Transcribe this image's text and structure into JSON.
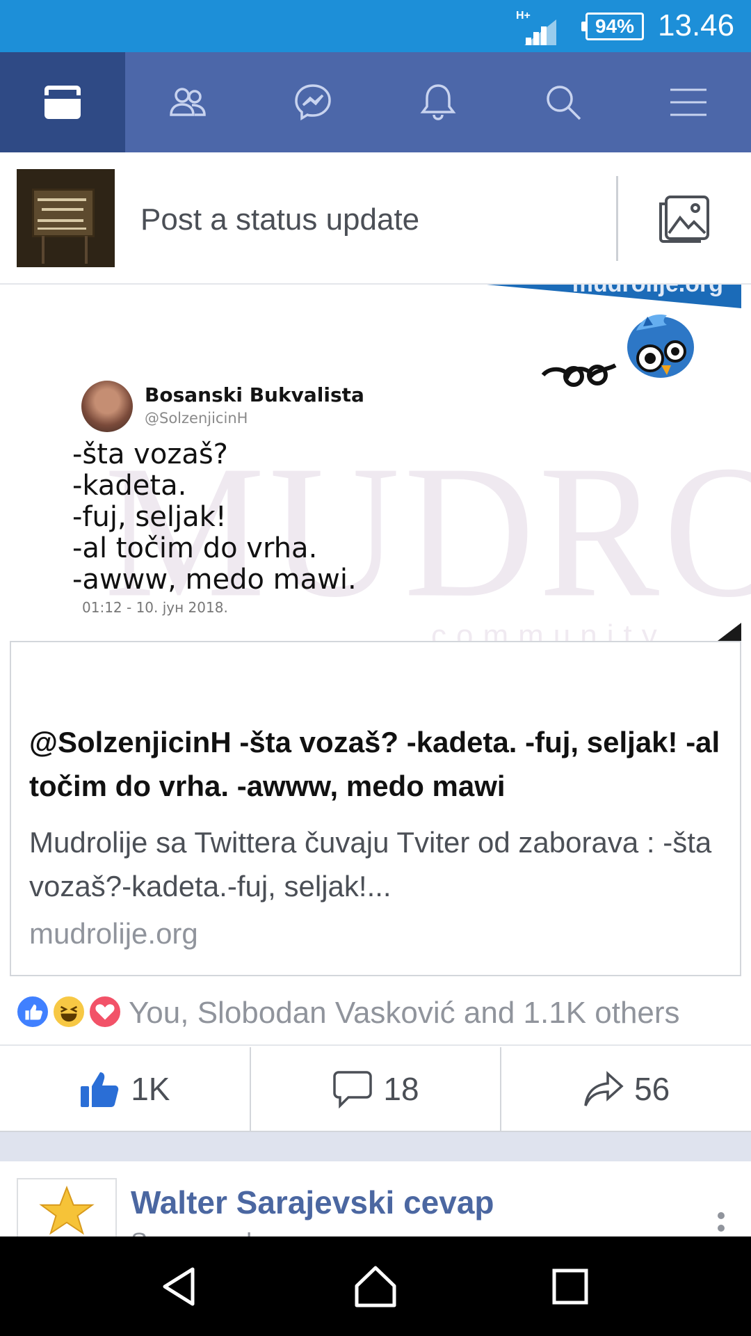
{
  "status_bar": {
    "network": "H+",
    "battery": "94%",
    "time": "13.46"
  },
  "top_nav": {
    "tabs": [
      {
        "name": "news-feed",
        "icon": "news-feed-icon",
        "active": true
      },
      {
        "name": "friends",
        "icon": "friends-icon",
        "active": false
      },
      {
        "name": "messenger",
        "icon": "messenger-icon",
        "active": false
      },
      {
        "name": "notifications",
        "icon": "bell-icon",
        "active": false
      },
      {
        "name": "search",
        "icon": "search-icon",
        "active": false
      },
      {
        "name": "menu",
        "icon": "hamburger-icon",
        "active": false
      }
    ],
    "colors": {
      "bar": "#4c67a9",
      "active": "#2f4a85",
      "status": "#1d8fd8"
    }
  },
  "composer": {
    "placeholder": "Post a status update",
    "photo_icon": "photo-icon"
  },
  "post": {
    "image": {
      "banner": "mudrolije.org",
      "watermark": "MUDROLIJE",
      "watermark_sub": "community",
      "tweet_name": "Bosanski Bukvalista",
      "tweet_handle": "@SolzenjicinH",
      "tweet_lines": [
        "-šta vozaš?",
        "-kadeta.",
        "-fuj, seljak!",
        "-al točim do vrha.",
        "-awww, medo mawi."
      ],
      "tweet_date": "01:12 - 10. јун 2018."
    },
    "link": {
      "title": "@SolzenjicinH -šta vozaš? -kadeta. -fuj, seljak! -al točim do vrha. -awww, medo mawi",
      "description": "Mudrolije sa Twittera čuvaju Tviter od zaborava : -šta vozaš?-kadeta.-fuj, seljak!...",
      "domain": "mudrolije.org"
    },
    "reactions": {
      "icons": [
        "like-reaction-icon",
        "haha-reaction-icon",
        "love-reaction-icon"
      ],
      "summary": "You, Slobodan Vasković and 1.1K others"
    },
    "actions": {
      "likes": "1K",
      "comments": "18",
      "shares": "56",
      "like_color": "#2a6ed6"
    }
  },
  "next_post": {
    "page_name": "Walter Sarajevski cevap",
    "subtitle": "Sponsored"
  },
  "nav_bar": {
    "buttons": [
      "back-icon",
      "home-icon",
      "recents-icon"
    ]
  }
}
